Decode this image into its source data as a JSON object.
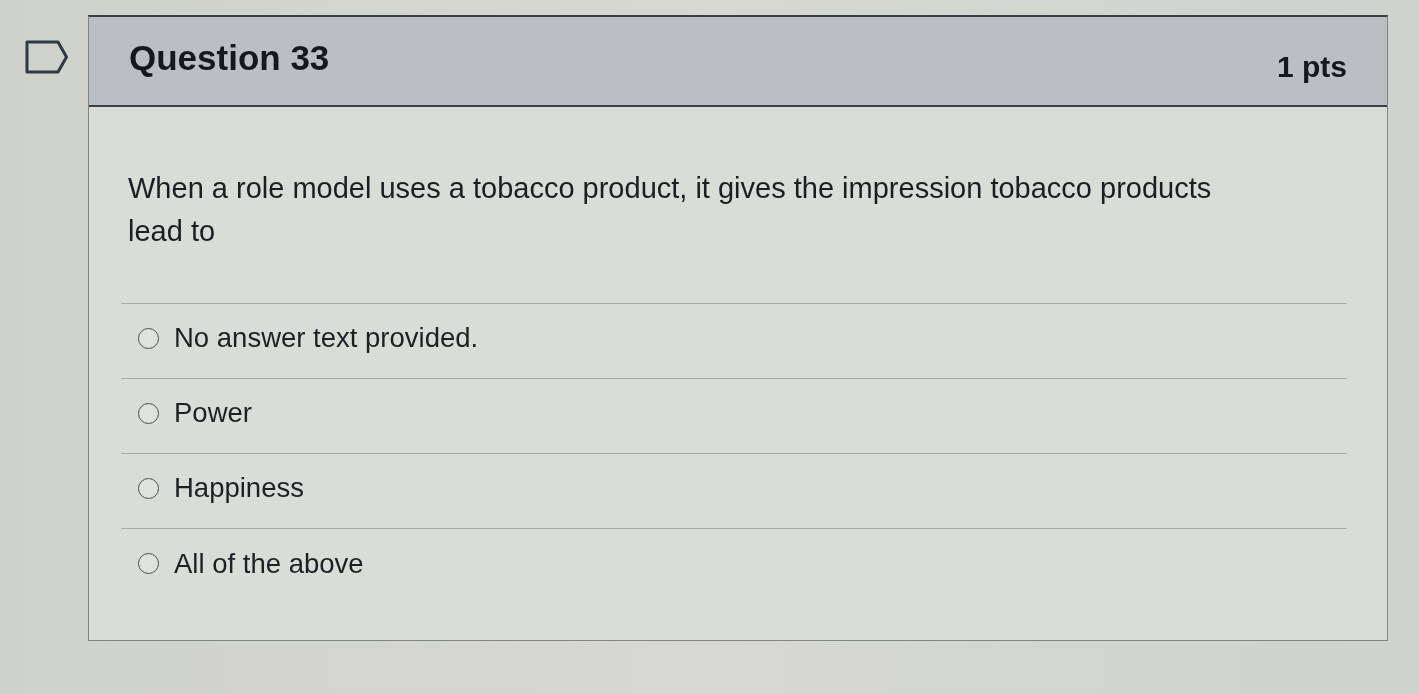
{
  "flag": {
    "flagged": false
  },
  "question": {
    "title": "Question 33",
    "points": "1 pts",
    "text": "When a role model uses a tobacco product, it gives the impression tobacco products lead to",
    "answers": [
      {
        "label": "No answer text provided.",
        "selected": false
      },
      {
        "label": "Power",
        "selected": false
      },
      {
        "label": "Happiness",
        "selected": false
      },
      {
        "label": "All of the above",
        "selected": false
      }
    ]
  }
}
